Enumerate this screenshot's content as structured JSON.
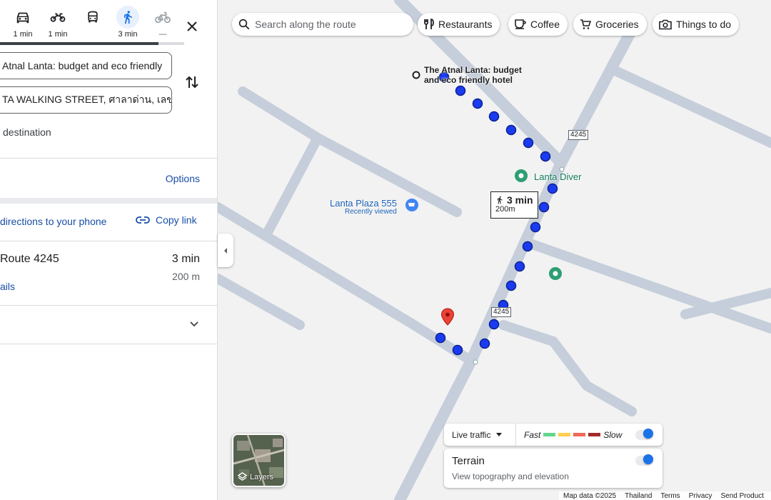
{
  "travel_modes": [
    {
      "name": "car",
      "time": "1 min"
    },
    {
      "name": "motorcycle",
      "time": "1 min"
    },
    {
      "name": "transit",
      "time": ""
    },
    {
      "name": "walking",
      "time": "3 min"
    },
    {
      "name": "cycling",
      "time": "—"
    }
  ],
  "directions": {
    "origin": "Atnal Lanta: budget and eco friendly",
    "destination": "TA WALKING STREET, ศาลาด่าน, เลขที",
    "add_destination": "destination",
    "options": "Options",
    "send_to_phone": "directions to your phone",
    "copy_link": "Copy link"
  },
  "route": {
    "name": "Route 4245",
    "time": "3 min",
    "distance": "200 m",
    "details": "ails"
  },
  "map": {
    "search_placeholder": "Search along the route",
    "chips": [
      "Restaurants",
      "Coffee",
      "Groceries",
      "Things to do"
    ],
    "hotel_label_1": "The Atnal Lanta: budget",
    "hotel_label_2": "and eco friendly hotel",
    "diver_label": "Lanta Diver",
    "plaza_label": "Lanta Plaza 555",
    "plaza_sub": "Recently viewed",
    "shield_1": "4245",
    "shield_2": "4245",
    "eta_time": "3 min",
    "eta_dist": "200m",
    "layers": "Layers",
    "live_traffic": "Live traffic",
    "fast": "Fast",
    "slow": "Slow",
    "terrain_title": "Terrain",
    "terrain_sub": "View topography and elevation",
    "footer": [
      "Map data ©2025",
      "Thailand",
      "Terms",
      "Privacy",
      "Send Product"
    ]
  },
  "colors": {
    "route_dot": "#1a3bef",
    "road": "#c5ceda",
    "link": "#174ea6",
    "traffic_fast": "#63d68c",
    "traffic_medium": "#ffcf4d",
    "traffic_slow": "#f2685a",
    "traffic_slowest": "#a52a2a"
  }
}
